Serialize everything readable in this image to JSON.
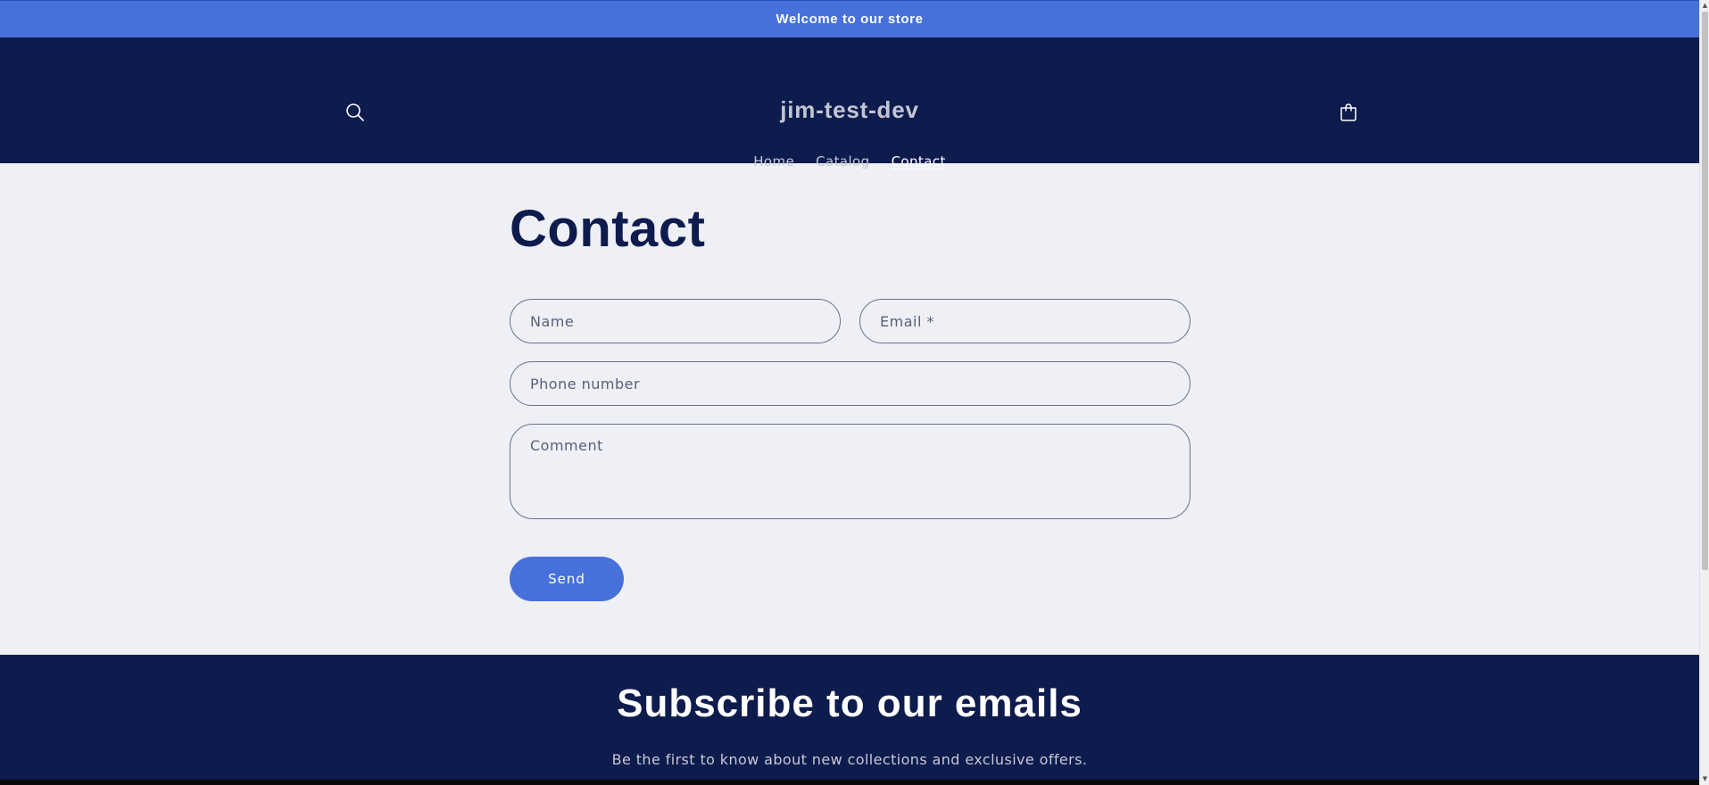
{
  "announcement": {
    "text": "Welcome to our store"
  },
  "header": {
    "brand": "jim-test-dev",
    "nav": [
      {
        "label": "Home",
        "active": false
      },
      {
        "label": "Catalog",
        "active": false
      },
      {
        "label": "Contact",
        "active": true
      }
    ],
    "search_icon": "search-icon",
    "cart_icon": "cart-icon"
  },
  "contact": {
    "title": "Contact",
    "fields": {
      "name_placeholder": "Name",
      "email_placeholder": "Email *",
      "phone_placeholder": "Phone number",
      "comment_placeholder": "Comment"
    },
    "send_label": "Send"
  },
  "newsletter": {
    "title": "Subscribe to our emails",
    "text": "Be the first to know about new collections and exclusive offers."
  },
  "colors": {
    "accent": "#4770db",
    "navy": "#0e1b4d",
    "background": "#eff0f5"
  }
}
